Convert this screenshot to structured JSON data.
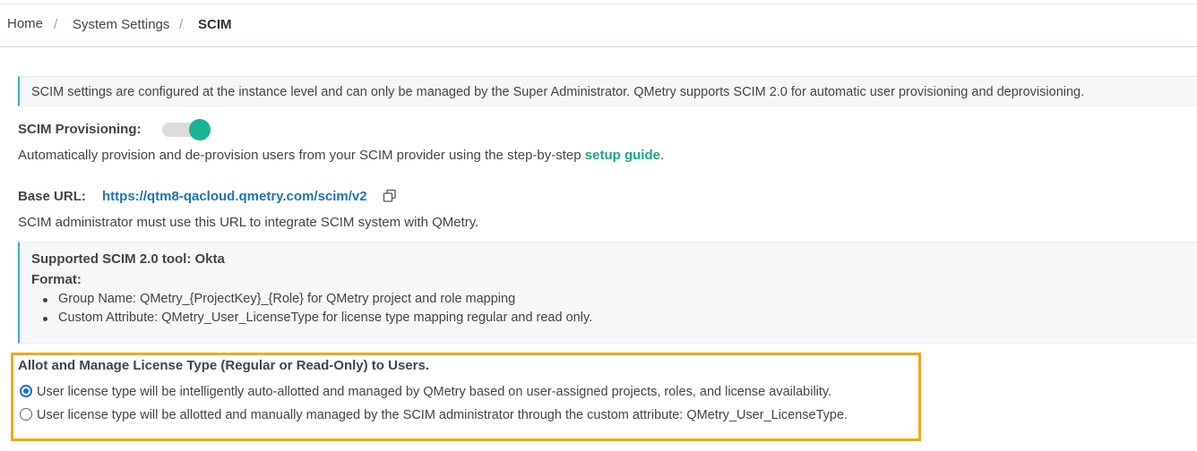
{
  "breadcrumb": {
    "home": "Home",
    "system_settings": "System Settings",
    "current": "SCIM",
    "separator": "/"
  },
  "notice": "SCIM settings are configured at the instance level and can only be managed by the Super Administrator. QMetry supports SCIM 2.0 for automatic user provisioning and deprovisioning.",
  "provisioning": {
    "label": "SCIM Provisioning:",
    "enabled": true,
    "desc_prefix": "Automatically provision and de-provision users from your SCIM provider using the step-by-step ",
    "guide_link": "setup guide",
    "desc_suffix": "."
  },
  "base_url": {
    "label": "Base URL:",
    "url": "https://qtm8-qacloud.qmetry.com/scim/v2",
    "copy_icon": "copy-icon",
    "note": "SCIM administrator must use this URL to integrate SCIM system with QMetry."
  },
  "tool": {
    "title": "Supported SCIM 2.0 tool: Okta",
    "format_label": "Format:",
    "items": [
      "Group Name: QMetry_{ProjectKey}_{Role} for QMetry project and role mapping",
      "Custom Attribute: QMetry_User_LicenseType for license type mapping regular and read only."
    ]
  },
  "license": {
    "title": "Allot and Manage License Type (Regular or Read-Only) to Users.",
    "options": [
      {
        "label": "User license type will be intelligently auto-allotted and managed by QMetry based on user-assigned projects, roles, and license availability.",
        "selected": true
      },
      {
        "label": "User license type will be allotted and manually managed by the SCIM administrator through the custom attribute: QMetry_User_LicenseType.",
        "selected": false
      }
    ]
  },
  "colors": {
    "accent": "#1ab394",
    "link": "#1f73b7",
    "highlight": "#f0a818",
    "info_border": "#3ab0c9"
  }
}
